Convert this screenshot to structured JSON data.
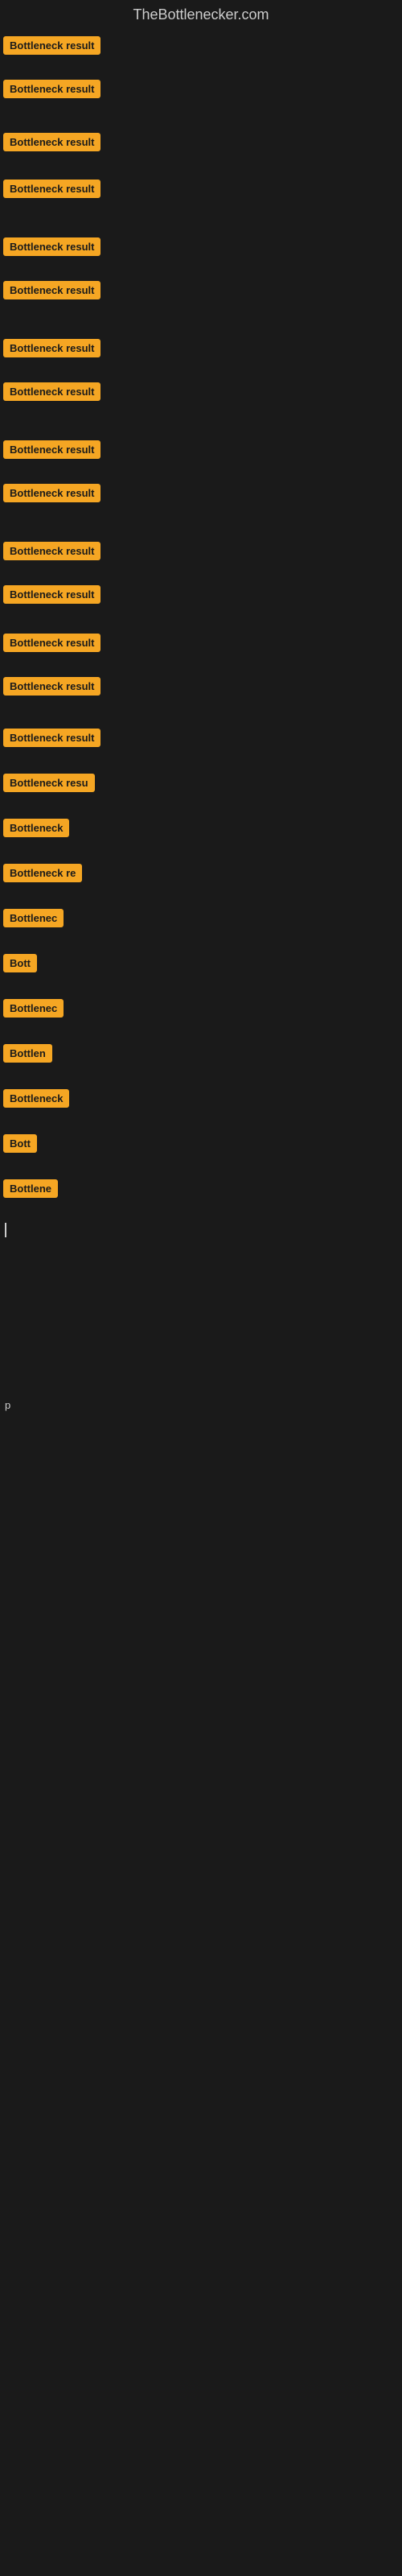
{
  "site": {
    "title": "TheBottlenecker.com"
  },
  "items": [
    {
      "id": 1,
      "label": "Bottleneck result",
      "width": 130
    },
    {
      "id": 2,
      "label": "Bottleneck result",
      "width": 130
    },
    {
      "id": 3,
      "label": "Bottleneck result",
      "width": 130
    },
    {
      "id": 4,
      "label": "Bottleneck result",
      "width": 130
    },
    {
      "id": 5,
      "label": "Bottleneck result",
      "width": 130
    },
    {
      "id": 6,
      "label": "Bottleneck result",
      "width": 130
    },
    {
      "id": 7,
      "label": "Bottleneck result",
      "width": 130
    },
    {
      "id": 8,
      "label": "Bottleneck result",
      "width": 130
    },
    {
      "id": 9,
      "label": "Bottleneck result",
      "width": 130
    },
    {
      "id": 10,
      "label": "Bottleneck result",
      "width": 130
    },
    {
      "id": 11,
      "label": "Bottleneck result",
      "width": 130
    },
    {
      "id": 12,
      "label": "Bottleneck result",
      "width": 130
    },
    {
      "id": 13,
      "label": "Bottleneck result",
      "width": 130
    },
    {
      "id": 14,
      "label": "Bottleneck result",
      "width": 130
    },
    {
      "id": 15,
      "label": "Bottleneck result",
      "width": 130
    },
    {
      "id": 16,
      "label": "Bottleneck resu",
      "width": 120
    },
    {
      "id": 17,
      "label": "Bottleneck",
      "width": 90
    },
    {
      "id": 18,
      "label": "Bottleneck re",
      "width": 105
    },
    {
      "id": 19,
      "label": "Bottlenec",
      "width": 80
    },
    {
      "id": 20,
      "label": "Bott",
      "width": 45
    },
    {
      "id": 21,
      "label": "Bottlenec",
      "width": 80
    },
    {
      "id": 22,
      "label": "Bottlen",
      "width": 65
    },
    {
      "id": 23,
      "label": "Bottleneck",
      "width": 90
    },
    {
      "id": 24,
      "label": "Bott",
      "width": 45
    },
    {
      "id": 25,
      "label": "Bottlene",
      "width": 72
    }
  ],
  "colors": {
    "badge_bg": "#f5a623",
    "body_bg": "#1a1a1a",
    "text": "#cccccc"
  }
}
